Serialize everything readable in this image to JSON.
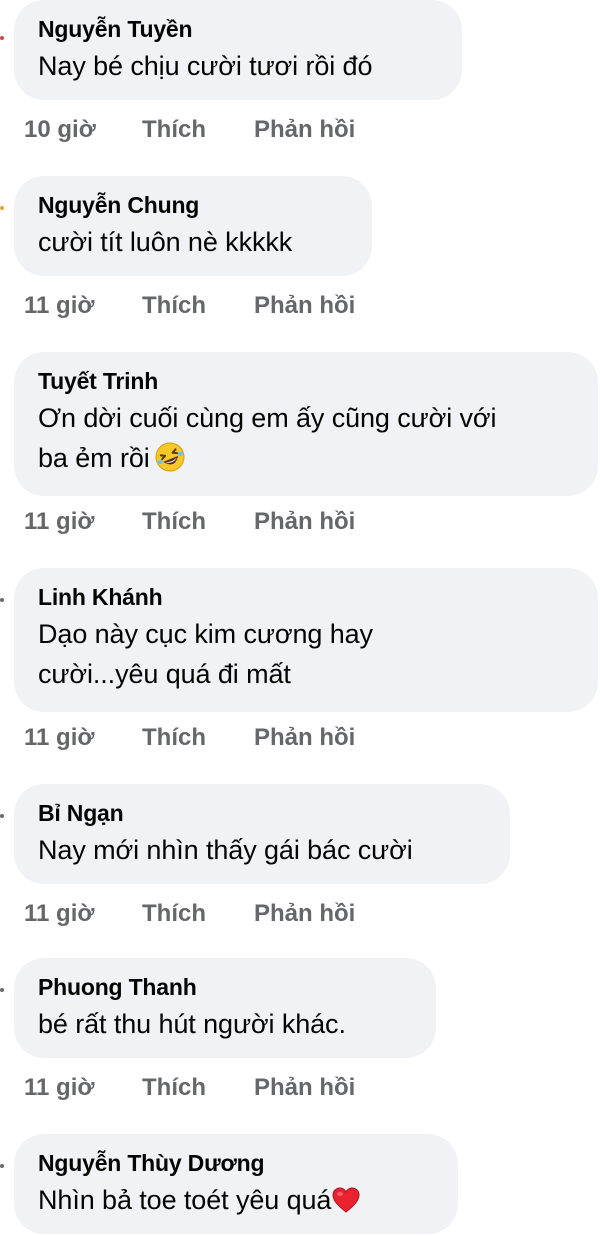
{
  "actions": {
    "like_label": "Thích",
    "reply_label": "Phản hồi"
  },
  "comments": [
    {
      "author": "Nguyễn Tuyền",
      "lines": [
        "Nay bé chịu cười tươi rồi đó"
      ],
      "time": "10 giờ"
    },
    {
      "author": "Nguyễn Chung",
      "lines": [
        "cười tít luôn nè kkkkk"
      ],
      "time": "11 giờ"
    },
    {
      "author": "Tuyết Trinh",
      "lines": [
        "Ơn dời cuối cùng em ấy cũng cười với",
        "ba ẻm rồi"
      ],
      "emoji": "rolling-on-floor-laughing-emoji",
      "time": "11 giờ"
    },
    {
      "author": "Linh Khánh",
      "lines": [
        "Dạo này cục kim cương hay",
        "cười...yêu quá đi mất"
      ],
      "time": "11 giờ"
    },
    {
      "author": "Bỉ Ngạn",
      "lines": [
        "Nay mới nhìn thấy gái bác cười"
      ],
      "time": "11 giờ"
    },
    {
      "author": "Phuong Thanh",
      "lines": [
        "bé rất thu hút người khác."
      ],
      "time": "11 giờ"
    },
    {
      "author": "Nguyễn Thùy Dương",
      "lines": [
        "Nhìn bả toe toét yêu quá"
      ],
      "emoji": "red-heart-emoji"
    }
  ]
}
